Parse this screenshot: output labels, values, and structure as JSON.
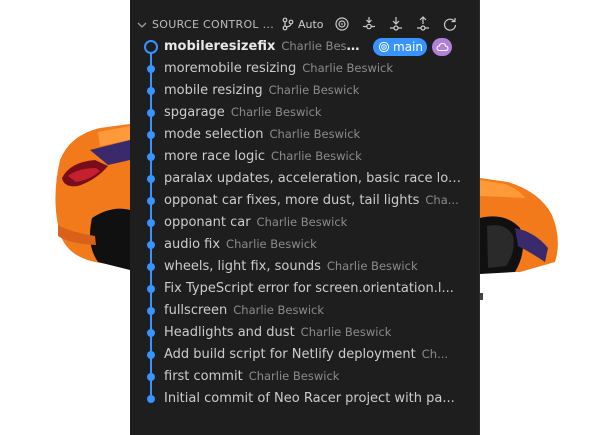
{
  "source_control": {
    "title": "SOURCE CONTROL ...",
    "branch": "Auto",
    "icons": [
      "target-icon",
      "fetch-icon",
      "pull-icon",
      "push-icon",
      "refresh-icon"
    ]
  },
  "graph": {
    "head_badge": "main",
    "head_badge_icon": "target-icon",
    "remote_badge_icon": "cloud-icon",
    "commits": [
      {
        "message": "mobileresizefix",
        "author": "Charlie Beswick"
      },
      {
        "message": "moremobile resizing",
        "author": "Charlie Beswick"
      },
      {
        "message": "mobile resizing",
        "author": "Charlie Beswick"
      },
      {
        "message": "spgarage",
        "author": "Charlie Beswick"
      },
      {
        "message": "mode selection",
        "author": "Charlie Beswick"
      },
      {
        "message": "more race logic",
        "author": "Charlie Beswick"
      },
      {
        "message": "paralax updates, acceleration, basic race lo...",
        "author": ""
      },
      {
        "message": "opponat car fixes, more dust, tail lights",
        "author": "Cha..."
      },
      {
        "message": "opponant car",
        "author": "Charlie Beswick"
      },
      {
        "message": "audio fix",
        "author": "Charlie Beswick"
      },
      {
        "message": "wheels, light fix, sounds",
        "author": "Charlie Beswick"
      },
      {
        "message": "Fix TypeScript error for screen.orientation.l...",
        "author": ""
      },
      {
        "message": "fullscreen",
        "author": "Charlie Beswick"
      },
      {
        "message": "Headlights and dust",
        "author": "Charlie Beswick"
      },
      {
        "message": "Add build script for Netlify deployment",
        "author": "Ch..."
      },
      {
        "message": "first commit",
        "author": "Charlie Beswick"
      },
      {
        "message": "Initial commit of Neo Racer project with pa...",
        "author": ""
      }
    ]
  },
  "colors": {
    "panel_bg": "#1e1e1e",
    "graph_blue": "#3794ff",
    "cloud_badge": "#b180d7",
    "car_orange": "#f27a1a"
  }
}
